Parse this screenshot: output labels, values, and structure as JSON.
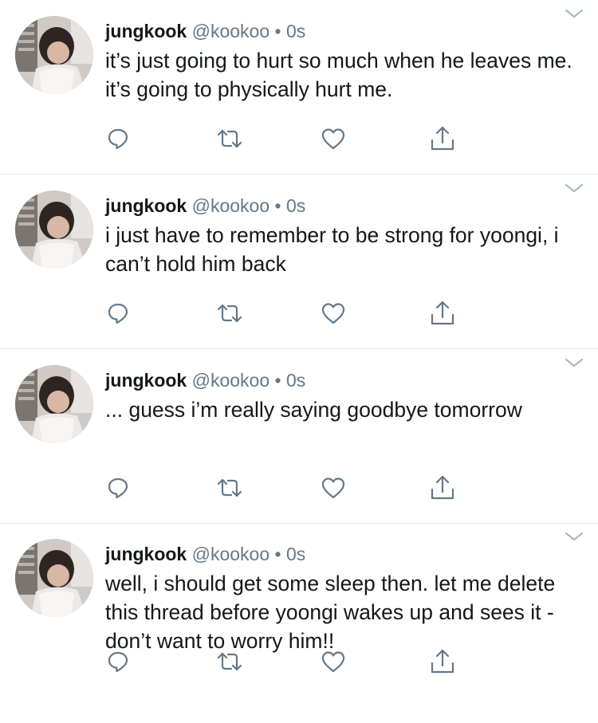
{
  "colors": {
    "name": "#14171a",
    "meta": "#657786",
    "icon": "#657786",
    "divider": "#e1e8ed"
  },
  "icons": [
    "reply-icon",
    "retweet-icon",
    "like-icon",
    "share-icon",
    "chevron-down-icon"
  ],
  "tweets": [
    {
      "name": "jungkook",
      "handle": "@kookoo",
      "sep": "•",
      "time": "0s",
      "text": "it’s just going to hurt so much when he leaves me. it’s going to physically hurt me."
    },
    {
      "name": "jungkook",
      "handle": "@kookoo",
      "sep": "•",
      "time": "0s",
      "text": "i just have to remember to be strong for yoongi, i can’t hold him back"
    },
    {
      "name": "jungkook",
      "handle": "@kookoo",
      "sep": "•",
      "time": "0s",
      "text": "... guess i’m really saying goodbye tomorrow"
    },
    {
      "name": "jungkook",
      "handle": "@kookoo",
      "sep": "•",
      "time": "0s",
      "text": "well, i should get some sleep then. let me delete this thread before yoongi wakes up and sees it - don’t want to worry him!!"
    }
  ]
}
